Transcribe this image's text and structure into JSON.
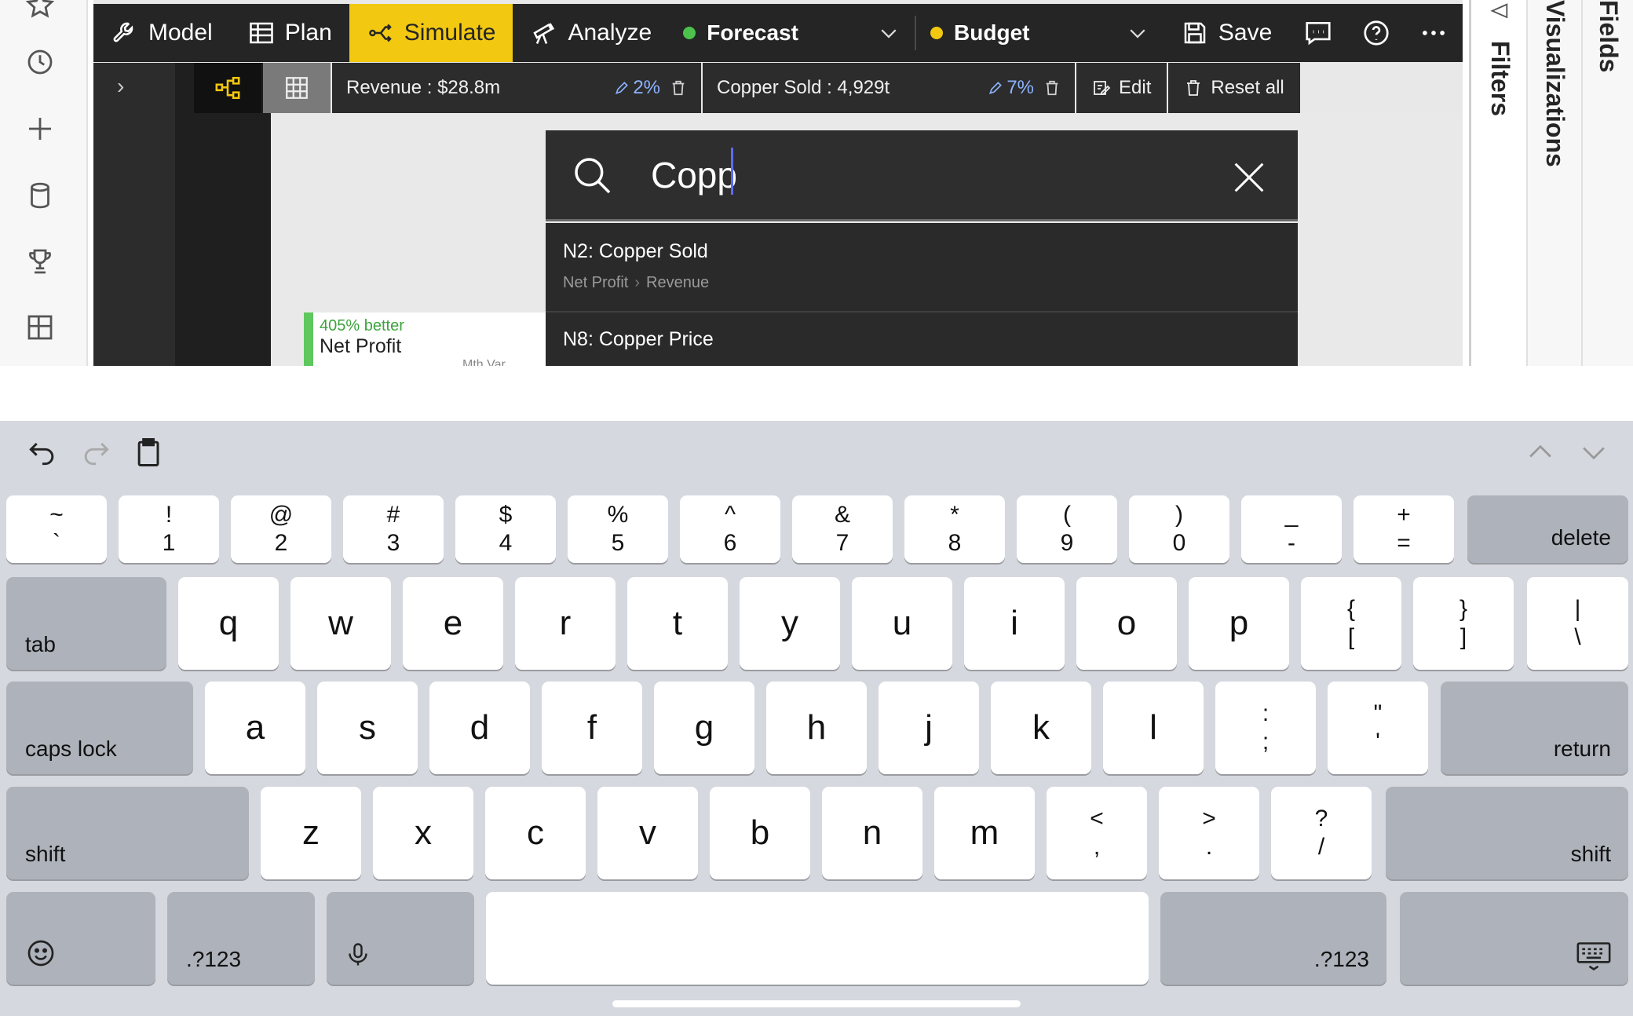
{
  "toolbar": {
    "model": "Model",
    "plan": "Plan",
    "simulate": "Simulate",
    "analyze": "Analyze",
    "forecast": "Forecast",
    "budget": "Budget",
    "save": "Save",
    "colors": {
      "active_bg": "#f2c811",
      "forecast_dot": "#4cc24c",
      "budget_dot": "#f2c811",
      "bar_bg": "#252525"
    }
  },
  "chips": {
    "revenue": "Revenue : $28.8m",
    "revenue_pct": "2%",
    "copper": "Copper Sold : 4,929t",
    "copper_pct": "7%",
    "edit": "Edit",
    "reset": "Reset all"
  },
  "search": {
    "value": "Copp",
    "placeholder": ""
  },
  "results": [
    {
      "title": "N2: Copper Sold",
      "path": [
        "Net Profit",
        "Revenue"
      ]
    },
    {
      "title": "N8: Copper Price",
      "path": []
    }
  ],
  "kpi": {
    "better": "405% better",
    "name": "Net Profit",
    "mth": "Mth Var"
  },
  "panes": {
    "filters": "Filters",
    "visualizations": "Visualizations",
    "fields": "Fields"
  },
  "keyboard": {
    "row1": [
      {
        "top": "~",
        "bottom": "`"
      },
      {
        "top": "!",
        "bottom": "1"
      },
      {
        "top": "@",
        "bottom": "2"
      },
      {
        "top": "#",
        "bottom": "3"
      },
      {
        "top": "$",
        "bottom": "4"
      },
      {
        "top": "%",
        "bottom": "5"
      },
      {
        "top": "^",
        "bottom": "6"
      },
      {
        "top": "&",
        "bottom": "7"
      },
      {
        "top": "*",
        "bottom": "8"
      },
      {
        "top": "(",
        "bottom": "9"
      },
      {
        "top": ")",
        "bottom": "0"
      },
      {
        "top": "_",
        "bottom": "-"
      },
      {
        "top": "+",
        "bottom": "="
      }
    ],
    "delete": "delete",
    "tab": "tab",
    "row2": [
      "q",
      "w",
      "e",
      "r",
      "t",
      "y",
      "u",
      "i",
      "o",
      "p"
    ],
    "row2_sym": [
      {
        "top": "{",
        "bottom": "["
      },
      {
        "top": "}",
        "bottom": "]"
      },
      {
        "top": "|",
        "bottom": "\\"
      }
    ],
    "caps": "caps lock",
    "row3": [
      "a",
      "s",
      "d",
      "f",
      "g",
      "h",
      "j",
      "k",
      "l"
    ],
    "row3_sym": [
      {
        "top": ":",
        "bottom": ";"
      },
      {
        "top": "\"",
        "bottom": "'"
      }
    ],
    "return": "return",
    "shift": "shift",
    "row4": [
      "z",
      "x",
      "c",
      "v",
      "b",
      "n",
      "m"
    ],
    "row4_sym": [
      {
        "top": "<",
        "bottom": ","
      },
      {
        "top": ">",
        "bottom": "."
      },
      {
        "top": "?",
        "bottom": "/"
      }
    ],
    "numbers": ".?123"
  }
}
